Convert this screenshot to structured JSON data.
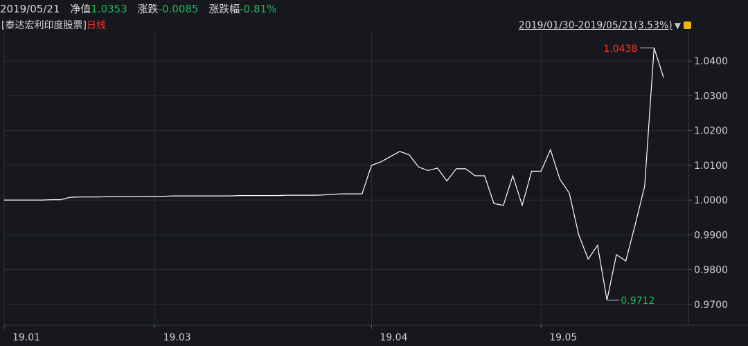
{
  "header": {
    "date": "2019/05/21",
    "nav_label": "净值",
    "nav_value": "1.0353",
    "change_label": "涨跌",
    "change_value": "-0.0085",
    "pct_label": "涨跌幅",
    "pct_value": "-0.81%"
  },
  "subheader": {
    "fund_name": "[泰达宏利印度股票]",
    "period": "日线",
    "range_text": "2019/01/30-2019/05/21(",
    "range_pct": "3.53%",
    "range_close": ")"
  },
  "colors": {
    "background": "#16181d",
    "grid": "#2c2f36",
    "line": "#ffffff",
    "up": "#ff3030",
    "down": "#1fb85a"
  },
  "chart_data": {
    "type": "line",
    "title": "",
    "xlabel": "",
    "ylabel": "",
    "ylim": [
      0.964,
      1.048
    ],
    "yticks": [
      "1.0400",
      "1.0300",
      "1.0200",
      "1.0100",
      "1.0000",
      "0.9900",
      "0.9800",
      "0.9700"
    ],
    "x_categories": [
      "19.01",
      "19.03",
      "19.04",
      "19.05"
    ],
    "annotations": {
      "max_label": "1.0438",
      "min_label": "0.9712"
    },
    "series": [
      {
        "values": [
          1.0,
          1.0,
          1.0,
          1.0,
          1.0,
          1.0001,
          1.0001,
          1.0008,
          1.0009,
          1.0009,
          1.0009,
          1.001,
          1.001,
          1.001,
          1.001,
          1.0011,
          1.0011,
          1.0011,
          1.0012,
          1.0012,
          1.0012,
          1.0012,
          1.0012,
          1.0012,
          1.0012,
          1.0013,
          1.0013,
          1.0013,
          1.0013,
          1.0013,
          1.0014,
          1.0014,
          1.0014,
          1.0014,
          1.0015,
          1.0017,
          1.0018,
          1.0018,
          1.0018,
          1.01,
          1.011,
          1.0125,
          1.014,
          1.013,
          1.0095,
          1.0085,
          1.0092,
          1.0055,
          1.009,
          1.009,
          1.007,
          1.007,
          0.999,
          0.9985,
          1.007,
          0.9985,
          1.0083,
          1.0083,
          1.0145,
          1.006,
          1.002,
          0.99,
          0.983,
          0.987,
          0.9712,
          0.9843,
          0.9825,
          0.993,
          1.004,
          1.0438,
          1.0353
        ]
      }
    ]
  }
}
